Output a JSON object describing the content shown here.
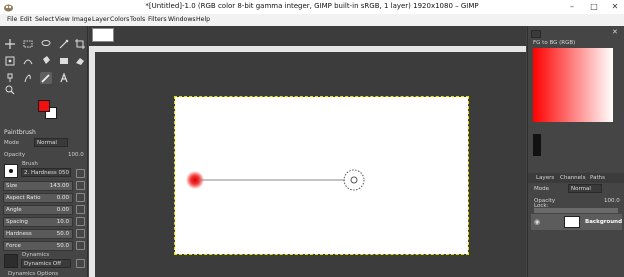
{
  "window": {
    "title": "*[Untitled]-1.0 (RGB color 8-bit gamma integer, GIMP built-in sRGB, 1 layer) 1920x1080 – GIMP",
    "controls": [
      "–",
      "□",
      "✕"
    ]
  },
  "menu": [
    "File",
    "Edit",
    "Select",
    "View",
    "Image",
    "Layer",
    "Colors",
    "Tools",
    "Filters",
    "Windows",
    "Help"
  ],
  "tool_options": {
    "title": "Paintbrush",
    "mode_label": "Mode",
    "mode_value": "Normal",
    "opacity_label": "Opacity",
    "opacity_value": "100.0",
    "brush_label": "Brush",
    "brush_value": "2. Hardness 050",
    "sliders": [
      {
        "label": "Size",
        "value": "143.00"
      },
      {
        "label": "Aspect Ratio",
        "value": "0.00"
      },
      {
        "label": "Angle",
        "value": "0.00"
      },
      {
        "label": "Spacing",
        "value": "10.0"
      },
      {
        "label": "Hardness",
        "value": "50.0"
      },
      {
        "label": "Force",
        "value": "50.0"
      }
    ],
    "dynamics_label": "Dynamics",
    "dynamics_value": "Dynamics Off",
    "dynamics_options": "Dynamics Options"
  },
  "colors": {
    "foreground": "#f01010",
    "background": "#ffffff",
    "accent": "#e5e500"
  },
  "dock": {
    "gradient_label": "FG to BG (RGB)",
    "tabs": [
      "Layers",
      "Channels",
      "Paths"
    ],
    "mode_label": "Mode",
    "mode_value": "Normal",
    "opacity_label": "Opacity",
    "opacity_value": "100.0",
    "lock_label": "Lock:",
    "layer_name": "Background"
  }
}
